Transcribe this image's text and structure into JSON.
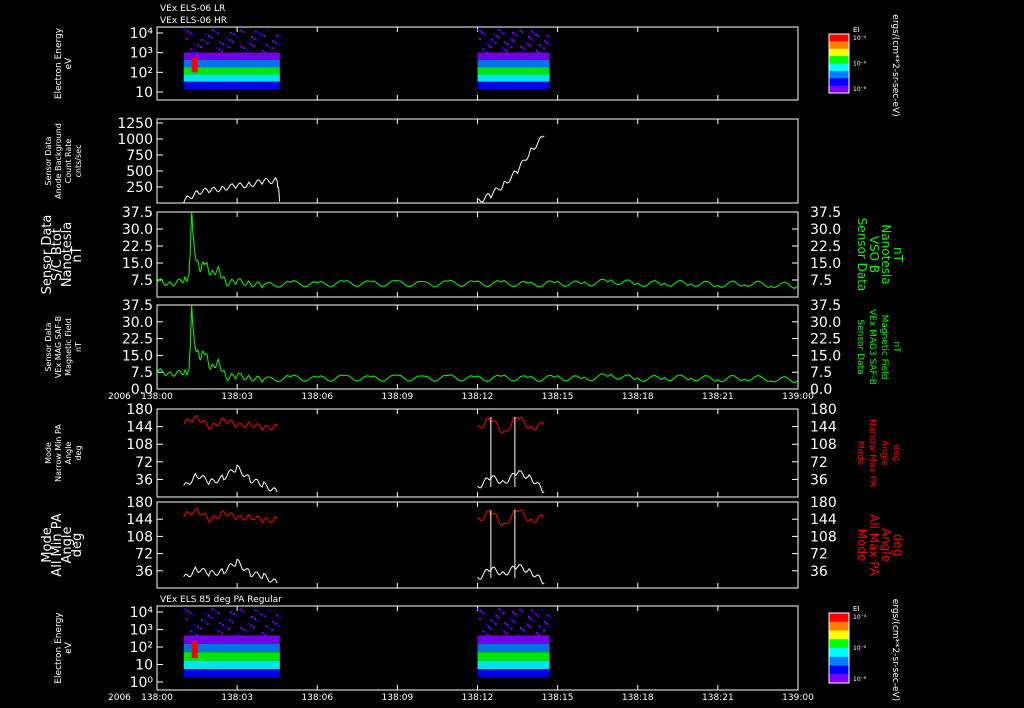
{
  "header": {
    "line1": "VEx ELS-06 LR",
    "line2": "VEx ELS-06 HR",
    "bottom_panel_title": "VEx ELS 85 deg PA Regular"
  },
  "time_axis": {
    "year_label": "2006",
    "ticks": [
      "138:00",
      "138:03",
      "138:06",
      "138:09",
      "138:12",
      "138:15",
      "138:18",
      "138:21",
      "139:00"
    ]
  },
  "colorbar": {
    "label": "EI",
    "ticks": [
      "10⁻⁴",
      "10⁻⁶",
      "10⁻⁸"
    ],
    "unit": "ergs/(cm**2-sr-sec-eV)",
    "colors": [
      "#ff0000",
      "#ff8000",
      "#ffff00",
      "#00ff00",
      "#00ffff",
      "#0080ff",
      "#0000ff",
      "#8000ff"
    ]
  },
  "colors": {
    "white": "#ffffff",
    "green": "#00ff00",
    "red": "#ff0000"
  },
  "chart_data": [
    {
      "type": "heatmap",
      "name": "spec1",
      "ylabel": [
        "Electron Energy",
        "eV"
      ],
      "y_ticks": [
        "10⁴",
        "10³",
        "10²",
        "10"
      ],
      "data_intervals": [
        [
          1.0,
          4.6
        ],
        [
          12.0,
          14.7
        ]
      ],
      "cmap_note": "log energy flux"
    },
    {
      "type": "line",
      "name": "sensor-bg",
      "ylabel": [
        "Sensor Data",
        "Anode Background",
        "Count Rate",
        "cnts/sec"
      ],
      "ylim": [
        0,
        1250
      ],
      "y_ticks": [
        "1250",
        "1000",
        "750",
        "500",
        "250"
      ],
      "series": [
        {
          "color": "#ffffff",
          "x": [
            1.0,
            1.5,
            2.0,
            2.5,
            3.0,
            3.5,
            4.0,
            4.5,
            4.6,
            12.0,
            12.5,
            13.0,
            13.5,
            14.0,
            14.5
          ],
          "y": [
            20,
            170,
            180,
            230,
            250,
            280,
            320,
            340,
            30,
            20,
            120,
            280,
            480,
            780,
            1000
          ]
        }
      ]
    },
    {
      "type": "line",
      "name": "btot",
      "ylabel": [
        "Sensor Data",
        "S/C Btot",
        "Nanotesla",
        "nT"
      ],
      "ylabel_right": [
        "Sensor Data",
        "VSO B",
        "Nanotesla",
        "nT"
      ],
      "ylim": [
        0,
        37.5
      ],
      "y_ticks": [
        "37.5",
        "30.0",
        "22.5",
        "15.0",
        "7.5"
      ],
      "series": [
        {
          "color": "#00ff00",
          "x": [
            0,
            0.5,
            1.0,
            1.2,
            1.3,
            1.4,
            1.6,
            1.8,
            2.0,
            2.3,
            2.6,
            3.0,
            3.5,
            4,
            5,
            6,
            7,
            8,
            9,
            10,
            11,
            12,
            13,
            14,
            15,
            16,
            17,
            18,
            19,
            20,
            21,
            22,
            23,
            24
          ],
          "y": [
            7,
            6,
            7,
            9,
            37,
            20,
            12,
            16,
            10,
            12,
            6,
            7,
            6,
            5,
            6,
            5.5,
            6,
            5.8,
            6,
            5.5,
            6,
            5.8,
            6,
            5.5,
            6,
            5.8,
            7,
            5.8,
            6,
            6,
            5.5,
            6,
            5.5,
            5
          ]
        }
      ]
    },
    {
      "type": "line",
      "name": "bmag",
      "ylabel": [
        "Sensor Data",
        "VEx MAG SAF-B",
        "Magnetic Field",
        "nT"
      ],
      "ylabel_right": [
        "Sensor Data",
        "VEx MAG3 SAF-B",
        "Magnetic Field",
        "nT"
      ],
      "ylim": [
        0,
        37.5
      ],
      "y_ticks": [
        "37.5",
        "30.0",
        "22.5",
        "15.0",
        "7.5",
        "0.0"
      ],
      "series": [
        {
          "color": "#00ff00",
          "x": [
            0,
            0.5,
            1.0,
            1.2,
            1.3,
            1.4,
            1.6,
            1.8,
            2.0,
            2.3,
            2.6,
            3.0,
            3.5,
            4,
            5,
            6,
            7,
            8,
            9,
            10,
            11,
            12,
            13,
            14,
            15,
            16,
            17,
            18,
            19,
            20,
            21,
            22,
            23,
            24
          ],
          "y": [
            8,
            7,
            7,
            8,
            36,
            20,
            14,
            17,
            9,
            12,
            5,
            6,
            5,
            4,
            5,
            4.5,
            5,
            4.5,
            5,
            4.5,
            5,
            4.5,
            5,
            4.5,
            5,
            4.5,
            6,
            4.5,
            5,
            5,
            4.5,
            5,
            4.5,
            4
          ]
        }
      ]
    },
    {
      "type": "line",
      "name": "pa-narrow",
      "ylabel": [
        "Mode",
        "Narrow Min PA",
        "Angle",
        "deg"
      ],
      "ylabel_right": [
        "Mode",
        "Narrow Max PA",
        "Angle",
        "deg"
      ],
      "ylim": [
        0,
        180
      ],
      "y_ticks": [
        "180",
        "144",
        "108",
        "72",
        "36"
      ],
      "series": [
        {
          "color": "#ff0000",
          "x": [
            1.0,
            1.5,
            2.0,
            2.5,
            3.0,
            3.5,
            4.0,
            4.5,
            12.0,
            12.5,
            13.0,
            13.5,
            14.0,
            14.5
          ],
          "y": [
            150,
            165,
            140,
            160,
            145,
            150,
            140,
            145,
            140,
            160,
            130,
            165,
            140,
            150
          ]
        },
        {
          "color": "#ffffff",
          "x": [
            1.0,
            1.5,
            2.0,
            2.5,
            3.0,
            3.5,
            4.0,
            4.5,
            12.0,
            12.5,
            13.0,
            13.5,
            14.0,
            14.5
          ],
          "y": [
            20,
            45,
            30,
            40,
            60,
            35,
            25,
            10,
            20,
            40,
            30,
            50,
            40,
            10
          ]
        }
      ]
    },
    {
      "type": "line",
      "name": "pa-all",
      "ylabel": [
        "Mode",
        "All Min PA",
        "Angle",
        "deg"
      ],
      "ylabel_right": [
        "Mode",
        "All Max PA",
        "Angle",
        "deg"
      ],
      "ylim": [
        0,
        180
      ],
      "y_ticks": [
        "180",
        "144",
        "108",
        "72",
        "36"
      ],
      "series": [
        {
          "color": "#ff0000",
          "x": [
            1.0,
            1.5,
            2.0,
            2.5,
            3.0,
            3.5,
            4.0,
            4.5,
            12.0,
            12.5,
            13.0,
            13.5,
            14.0,
            14.5
          ],
          "y": [
            150,
            165,
            140,
            160,
            145,
            150,
            140,
            145,
            140,
            160,
            130,
            165,
            140,
            150
          ]
        },
        {
          "color": "#ffffff",
          "x": [
            1.0,
            1.5,
            2.0,
            2.5,
            3.0,
            3.5,
            4.0,
            4.5,
            12.0,
            12.5,
            13.0,
            13.5,
            14.0,
            14.5
          ],
          "y": [
            20,
            40,
            30,
            35,
            55,
            30,
            25,
            10,
            20,
            40,
            30,
            45,
            35,
            10
          ]
        }
      ]
    },
    {
      "type": "heatmap",
      "name": "spec2",
      "ylabel": [
        "Electron Energy",
        "eV"
      ],
      "y_ticks": [
        "10⁴",
        "10³",
        "10²",
        "10",
        "10⁰"
      ],
      "data_intervals": [
        [
          1.0,
          4.6
        ],
        [
          12.0,
          14.7
        ]
      ],
      "cmap_note": "log energy flux"
    }
  ]
}
